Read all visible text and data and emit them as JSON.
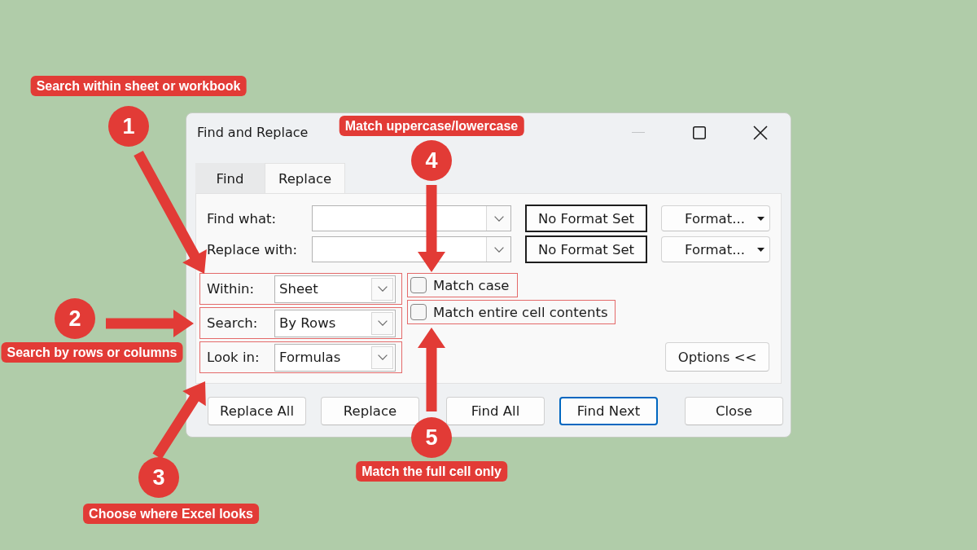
{
  "dialog": {
    "title": "Find and Replace",
    "window_controls": [
      {
        "kind": "minimize",
        "disabled": true
      },
      {
        "kind": "maximize",
        "disabled": false
      },
      {
        "kind": "close",
        "disabled": false
      }
    ],
    "tabs": [
      {
        "label": "Find",
        "selected": false
      },
      {
        "label": "Replace",
        "selected": true
      }
    ],
    "fields": [
      {
        "label": "Find what:",
        "format": "No Format Set",
        "format_button": "Format..."
      },
      {
        "label": "Replace with:",
        "format": "No Format Set",
        "format_button": "Format..."
      }
    ],
    "options": [
      {
        "label": "Within:",
        "value": "Sheet",
        "highlighted": true
      },
      {
        "label": "Search:",
        "value": "By Rows",
        "highlighted": true
      },
      {
        "label": "Look in:",
        "value": "Formulas",
        "highlighted": true
      }
    ],
    "checkboxes": [
      {
        "label": "Match case",
        "checked": false,
        "highlighted": true
      },
      {
        "label": "Match entire cell contents",
        "checked": false,
        "highlighted": true
      }
    ],
    "options_button": {
      "label": "Options <<"
    },
    "buttons": [
      {
        "label": "Replace All",
        "default": false
      },
      {
        "label": "Replace",
        "default": false
      },
      {
        "label": "Find All",
        "default": false
      },
      {
        "label": "Find Next",
        "default": true
      },
      {
        "label": "Close",
        "default": false
      }
    ]
  },
  "callouts": [
    {
      "number": "1",
      "text": "Search within sheet or workbook"
    },
    {
      "number": "2",
      "text": "Search by rows or columns"
    },
    {
      "number": "3",
      "text": "Choose where Excel looks"
    },
    {
      "number": "4",
      "text": "Match uppercase/lowercase"
    },
    {
      "number": "5",
      "text": "Match the full cell only"
    }
  ]
}
